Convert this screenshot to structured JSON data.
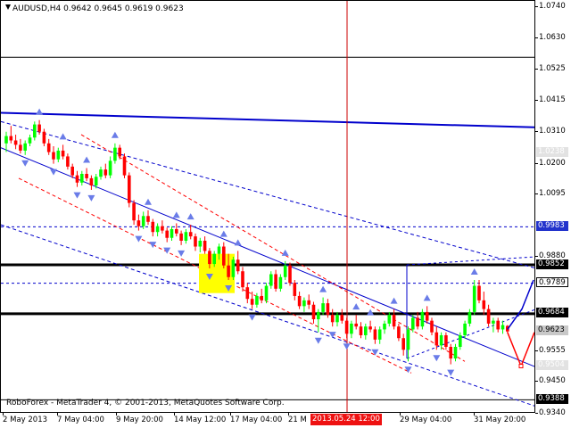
{
  "chart_header": {
    "title": "AUDUSD,H4 0.9642 0.9645 0.9619 0.9623",
    "copyright": "RoboForex - MetaTrader 4, © 2001-2013, MetaQuotes Software Corp."
  },
  "colors": {
    "bull": "#00ff00",
    "bear": "#ff0000",
    "level_line": "#000000",
    "trend_line": "#0000cc",
    "fractal": "#6a7ce8",
    "red_channel": "#ff0000",
    "cursor_line": "#cc0000",
    "price_tag": "#c8c8c8",
    "blue_tag": "#2233cc"
  },
  "chart_data": {
    "type": "candlestick",
    "symbol": "AUDUSD",
    "timeframe": "H4",
    "last_bar": {
      "open": 0.9642,
      "high": 0.9645,
      "low": 0.9619,
      "close": 0.9623
    },
    "ylim": [
      0.934,
      1.076
    ],
    "y_ticks": [
      "1.0740",
      "1.0630",
      "1.0525",
      "1.0415",
      "1.0310",
      "1.0200",
      "1.0095",
      "0.9880",
      "0.9555",
      "0.9450",
      "0.9340"
    ],
    "x_ticks": [
      "2 May 2013",
      "7 May 04:00",
      "9 May 20:00",
      "14 May 12:00",
      "17 May 04:00",
      "21 M",
      "29 May 04:00",
      "31 May 20:00"
    ],
    "cursor_label": "2013.05.24 12:00",
    "price_tags": [
      {
        "label": "1.0238",
        "value": 1.0238,
        "style": "ghost"
      },
      {
        "label": "0.9983",
        "value": 0.9983,
        "style": "blue"
      },
      {
        "label": "0.9852",
        "value": 0.9852,
        "style": "black"
      },
      {
        "label": "0.9789",
        "value": 0.9789,
        "style": "white"
      },
      {
        "label": "0.9684",
        "value": 0.9684,
        "style": "black"
      },
      {
        "label": "0.9623",
        "value": 0.9623,
        "style": "grey"
      },
      {
        "label": "0.9504",
        "value": 0.9504,
        "style": "ghost"
      },
      {
        "label": "0.9388",
        "value": 0.9388,
        "style": "black"
      }
    ],
    "candles": [
      [
        1.027,
        1.031,
        1.024,
        1.0295
      ],
      [
        1.0295,
        1.033,
        1.027,
        1.028
      ],
      [
        1.028,
        1.03,
        1.025,
        1.0265
      ],
      [
        1.0265,
        1.0285,
        1.0235,
        1.0245
      ],
      [
        1.0245,
        1.028,
        1.023,
        1.027
      ],
      [
        1.027,
        1.03,
        1.026,
        1.029
      ],
      [
        1.029,
        1.0345,
        1.028,
        1.0335
      ],
      [
        1.0335,
        1.035,
        1.03,
        1.031
      ],
      [
        1.031,
        1.032,
        1.026,
        1.027
      ],
      [
        1.027,
        1.0285,
        1.023,
        1.024
      ],
      [
        1.024,
        1.026,
        1.02,
        1.0215
      ],
      [
        1.0215,
        1.0255,
        1.0205,
        1.0245
      ],
      [
        1.0245,
        1.0265,
        1.0215,
        1.0225
      ],
      [
        1.0225,
        1.0235,
        1.018,
        1.019
      ],
      [
        1.019,
        1.02,
        1.015,
        1.016
      ],
      [
        1.016,
        1.0175,
        1.012,
        1.0135
      ],
      [
        1.0135,
        1.0175,
        1.0125,
        1.0165
      ],
      [
        1.0165,
        1.0185,
        1.014,
        1.015
      ],
      [
        1.015,
        1.016,
        1.011,
        1.0125
      ],
      [
        1.0125,
        1.0165,
        1.0115,
        1.0155
      ],
      [
        1.0155,
        1.019,
        1.0145,
        1.018
      ],
      [
        1.018,
        1.02,
        1.015,
        1.016
      ],
      [
        1.016,
        1.0225,
        1.015,
        1.021
      ],
      [
        1.021,
        1.027,
        1.02,
        1.0255
      ],
      [
        1.0255,
        1.0265,
        1.0215,
        1.0225
      ],
      [
        1.0225,
        1.0235,
        1.015,
        1.016
      ],
      [
        1.016,
        1.017,
        1.005,
        1.0065
      ],
      [
        1.0065,
        1.0075,
        0.999,
        1.0005
      ],
      [
        1.0005,
        1.0025,
        0.997,
        0.9985
      ],
      [
        0.9985,
        1.0035,
        0.9975,
        1.002
      ],
      [
        1.002,
        1.004,
        0.999,
        1.0
      ],
      [
        1.0,
        1.001,
        0.995,
        0.9965
      ],
      [
        0.9965,
        0.9995,
        0.995,
        0.9985
      ],
      [
        0.9985,
        1.0005,
        0.996,
        0.997
      ],
      [
        0.997,
        0.998,
        0.993,
        0.9945
      ],
      [
        0.9945,
        0.9985,
        0.9935,
        0.9975
      ],
      [
        0.9975,
        0.9995,
        0.995,
        0.996
      ],
      [
        0.996,
        0.997,
        0.992,
        0.9935
      ],
      [
        0.9935,
        0.9975,
        0.9925,
        0.9965
      ],
      [
        0.9965,
        0.999,
        0.994,
        0.995
      ],
      [
        0.995,
        0.996,
        0.99,
        0.9915
      ],
      [
        0.9915,
        0.9945,
        0.9895,
        0.9935
      ],
      [
        0.9935,
        0.995,
        0.989,
        0.99
      ],
      [
        0.99,
        0.991,
        0.984,
        0.9855
      ],
      [
        0.9855,
        0.99,
        0.9845,
        0.989
      ],
      [
        0.989,
        0.9925,
        0.987,
        0.9915
      ],
      [
        0.9915,
        0.993,
        0.984,
        0.985
      ],
      [
        0.985,
        0.989,
        0.98,
        0.981
      ],
      [
        0.981,
        0.988,
        0.98,
        0.987
      ],
      [
        0.987,
        0.99,
        0.982,
        0.983
      ],
      [
        0.983,
        0.9845,
        0.976,
        0.9775
      ],
      [
        0.9775,
        0.979,
        0.972,
        0.9735
      ],
      [
        0.9735,
        0.976,
        0.97,
        0.9715
      ],
      [
        0.9715,
        0.9755,
        0.9705,
        0.9745
      ],
      [
        0.9745,
        0.977,
        0.972,
        0.973
      ],
      [
        0.973,
        0.979,
        0.972,
        0.978
      ],
      [
        0.978,
        0.983,
        0.977,
        0.982
      ],
      [
        0.982,
        0.9835,
        0.976,
        0.977
      ],
      [
        0.977,
        0.982,
        0.976,
        0.981
      ],
      [
        0.981,
        0.9865,
        0.98,
        0.985
      ],
      [
        0.985,
        0.986,
        0.978,
        0.979
      ],
      [
        0.979,
        0.98,
        0.973,
        0.9745
      ],
      [
        0.9745,
        0.976,
        0.97,
        0.971
      ],
      [
        0.971,
        0.974,
        0.969,
        0.973
      ],
      [
        0.973,
        0.975,
        0.97,
        0.9715
      ],
      [
        0.9715,
        0.9725,
        0.965,
        0.9665
      ],
      [
        0.9665,
        0.97,
        0.962,
        0.969
      ],
      [
        0.969,
        0.974,
        0.968,
        0.972
      ],
      [
        0.972,
        0.9735,
        0.967,
        0.968
      ],
      [
        0.968,
        0.97,
        0.964,
        0.9655
      ],
      [
        0.9655,
        0.969,
        0.964,
        0.968
      ],
      [
        0.968,
        0.97,
        0.965,
        0.966
      ],
      [
        0.966,
        0.967,
        0.96,
        0.9615
      ],
      [
        0.9615,
        0.966,
        0.96,
        0.965
      ],
      [
        0.965,
        0.968,
        0.963,
        0.964
      ],
      [
        0.964,
        0.9655,
        0.96,
        0.961
      ],
      [
        0.961,
        0.965,
        0.9595,
        0.964
      ],
      [
        0.964,
        0.966,
        0.962,
        0.963
      ],
      [
        0.963,
        0.964,
        0.958,
        0.9595
      ],
      [
        0.9595,
        0.964,
        0.958,
        0.963
      ],
      [
        0.963,
        0.966,
        0.9615,
        0.965
      ],
      [
        0.965,
        0.969,
        0.964,
        0.968
      ],
      [
        0.968,
        0.97,
        0.963,
        0.964
      ],
      [
        0.964,
        0.965,
        0.959,
        0.96
      ],
      [
        0.96,
        0.9615,
        0.954,
        0.956
      ],
      [
        0.956,
        0.964,
        0.952,
        0.963
      ],
      [
        0.963,
        0.968,
        0.962,
        0.967
      ],
      [
        0.967,
        0.969,
        0.963,
        0.964
      ],
      [
        0.964,
        0.97,
        0.963,
        0.969
      ],
      [
        0.969,
        0.971,
        0.965,
        0.966
      ],
      [
        0.966,
        0.967,
        0.961,
        0.962
      ],
      [
        0.962,
        0.964,
        0.956,
        0.9575
      ],
      [
        0.9575,
        0.962,
        0.956,
        0.961
      ],
      [
        0.961,
        0.962,
        0.956,
        0.957
      ],
      [
        0.957,
        0.958,
        0.951,
        0.953
      ],
      [
        0.953,
        0.958,
        0.952,
        0.957
      ],
      [
        0.957,
        0.962,
        0.956,
        0.961
      ],
      [
        0.961,
        0.966,
        0.96,
        0.965
      ],
      [
        0.965,
        0.97,
        0.964,
        0.969
      ],
      [
        0.969,
        0.98,
        0.968,
        0.978
      ],
      [
        0.978,
        0.98,
        0.972,
        0.973
      ],
      [
        0.973,
        0.976,
        0.968,
        0.97
      ],
      [
        0.97,
        0.9715,
        0.964,
        0.965
      ],
      [
        0.965,
        0.967,
        0.962,
        0.966
      ],
      [
        0.966,
        0.967,
        0.962,
        0.963
      ],
      [
        0.963,
        0.966,
        0.9615,
        0.9645
      ],
      [
        0.9642,
        0.9645,
        0.9619,
        0.9623
      ]
    ]
  }
}
